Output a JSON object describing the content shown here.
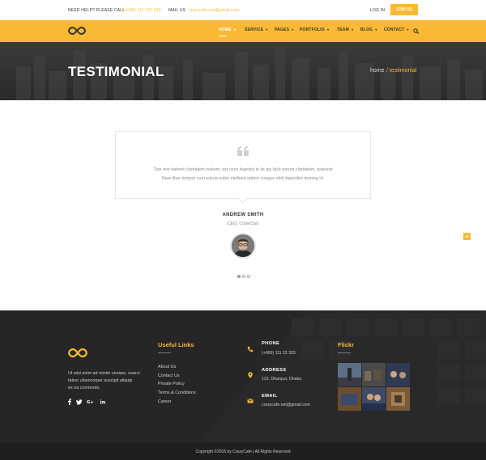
{
  "topbar": {
    "help_label": "NEED HELP? PLEASE CALL",
    "phone": "(+000) 111 222 333",
    "mail_label": "MAIL US",
    "email": "crazycafe.net@gmail.com",
    "login": "LOG IN",
    "join": "JOIN US"
  },
  "nav": {
    "items": [
      {
        "label": "HOME",
        "active": true
      },
      {
        "label": "SERVICE"
      },
      {
        "label": "PAGES"
      },
      {
        "label": "PORTFOLIO"
      },
      {
        "label": "TEAM"
      },
      {
        "label": "BLOG"
      },
      {
        "label": "CONTACT"
      }
    ]
  },
  "hero": {
    "title": "TESTIMONIAL",
    "breadcrumb_home": "home",
    "breadcrumb_current": "/ testimonial"
  },
  "testimonial": {
    "quote_line1": "Typi non habent claritatem insitam; est usus legentis in iis qui facit eorum claritatem. placerat",
    "quote_line2": "Nam liber tempor cum soluta nobis eleifend option congue nihil imperdiet doming id.",
    "name": "ANDREW SMITH",
    "role": "CEO, CodeClub",
    "slides_total": 3,
    "slide_active": 1
  },
  "footer": {
    "about_lines": [
      "Ut wisi enim ad minim veniam, exerci",
      "tation ullamcorper suscipit aliquip",
      "ex ea commodo."
    ],
    "social_icons": [
      "facebook-icon",
      "twitter-icon",
      "google-plus-icon",
      "linkedin-icon"
    ],
    "useful_links_title": "Useful Links",
    "useful_links": [
      "About Us",
      "Contact Us",
      "Private Policy",
      "Terms & Conditions",
      "Career"
    ],
    "contact": [
      {
        "title": "PHONE",
        "value": "(+000) 111 22 333",
        "icon": "phone-icon"
      },
      {
        "title": "ADDRESS",
        "value": "123, Dhanpur, Dhaka",
        "icon": "map-pin-icon"
      },
      {
        "title": "EMAIL",
        "value": "crazycafe.net@gmail.com",
        "icon": "envelope-icon"
      }
    ],
    "flickr_title": "Flickr",
    "copyright": "Copyright ©2016 by CrazyCafe  |  All Rights Reserved"
  },
  "colors": {
    "accent": "#f9b934",
    "hero_bg": "#2f2f2f",
    "footer_bg": "#262626"
  }
}
